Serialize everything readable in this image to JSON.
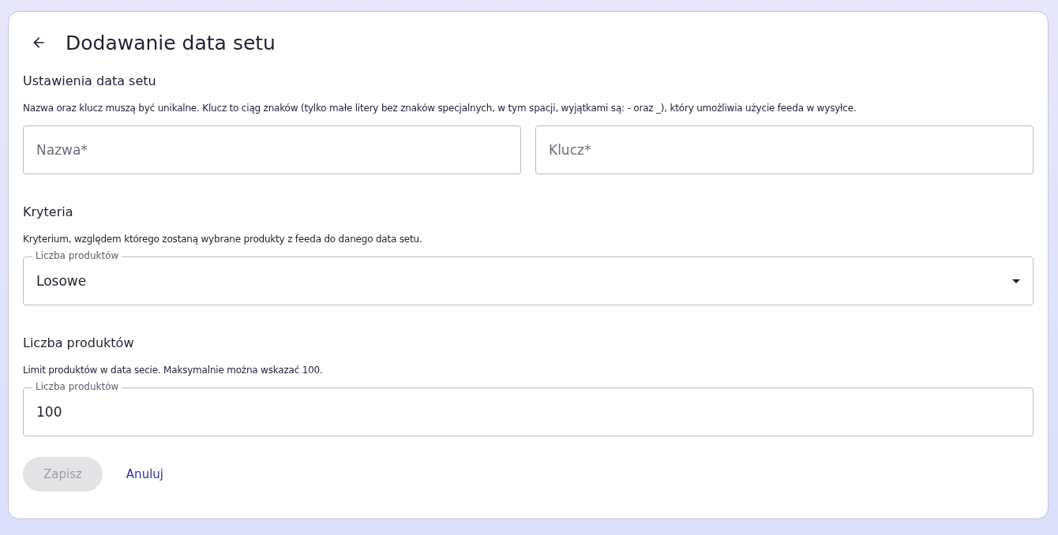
{
  "page": {
    "title": "Dodawanie data setu"
  },
  "sections": [
    {
      "heading": "Ustawienia data setu",
      "description": "Nazwa oraz klucz muszą być unikalne. Klucz to ciąg znaków (tylko małe litery bez znaków specjalnych, w tym spacji, wyjątkami są: - oraz _), który umożliwia użycie feeda w wysyłce.",
      "fields": [
        {
          "kind": "text",
          "placeholder": "Nazwa*"
        },
        {
          "kind": "text",
          "placeholder": "Klucz*"
        }
      ]
    },
    {
      "heading": "Kryteria",
      "description": "Kryterium, względem którego zostaną wybrane produkty z feeda do danego data setu.",
      "fields": [
        {
          "kind": "select",
          "label": "Liczba produktów",
          "value": "Losowe"
        }
      ]
    },
    {
      "heading": "Liczba produktów",
      "description": "Limit produktów w data secie. Maksymalnie można wskazać 100.",
      "fields": [
        {
          "kind": "number",
          "label": "Liczba produktów",
          "value": "100"
        }
      ]
    }
  ],
  "actions": {
    "save": {
      "label": "Zapisz",
      "disabled": true
    },
    "cancel": {
      "label": "Anuluj"
    }
  }
}
